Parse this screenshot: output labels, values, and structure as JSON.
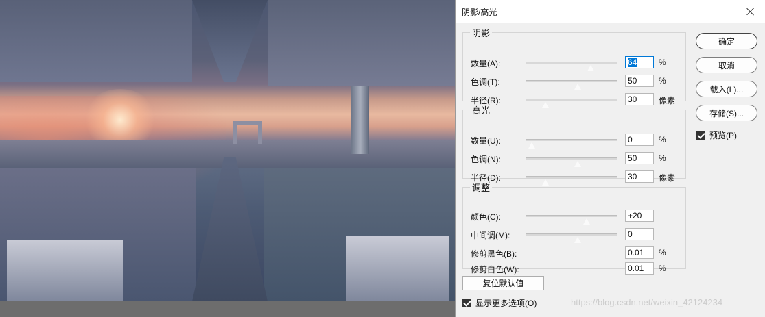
{
  "dialog": {
    "title": "阴影/高光",
    "close_icon": "close-icon"
  },
  "shadows": {
    "legend": "阴影",
    "rows": [
      {
        "label": "数量(A):",
        "value": "64",
        "unit": "%",
        "slider": 0.64
      },
      {
        "label": "色调(T):",
        "value": "50",
        "unit": "%",
        "slider": 0.5
      },
      {
        "label": "半径(R):",
        "value": "30",
        "unit": "像素",
        "slider": 0.15
      }
    ]
  },
  "highlights": {
    "legend": "高光",
    "rows": [
      {
        "label": "数量(U):",
        "value": "0",
        "unit": "%",
        "slider": 0.0
      },
      {
        "label": "色调(N):",
        "value": "50",
        "unit": "%",
        "slider": 0.5
      },
      {
        "label": "半径(D):",
        "value": "30",
        "unit": "像素",
        "slider": 0.15
      }
    ]
  },
  "adjustments": {
    "legend": "调整",
    "rows": [
      {
        "label": "颜色(C):",
        "value": "+20",
        "unit": "",
        "slider": 0.6
      },
      {
        "label": "中间调(M):",
        "value": "0",
        "unit": "",
        "slider": 0.5
      },
      {
        "label": "修剪黑色(B):",
        "value": "0.01",
        "unit": "%"
      },
      {
        "label": "修剪白色(W):",
        "value": "0.01",
        "unit": "%"
      }
    ]
  },
  "buttons": {
    "ok": "确定",
    "cancel": "取消",
    "load": "载入(L)...",
    "save": "存储(S)..."
  },
  "preview": {
    "label": "预览(P)",
    "checked": true
  },
  "reset_label": "复位默认值",
  "more_options": {
    "label": "显示更多选项(O)",
    "checked": true
  },
  "watermark": "https://blog.csdn.net/weixin_42124234"
}
